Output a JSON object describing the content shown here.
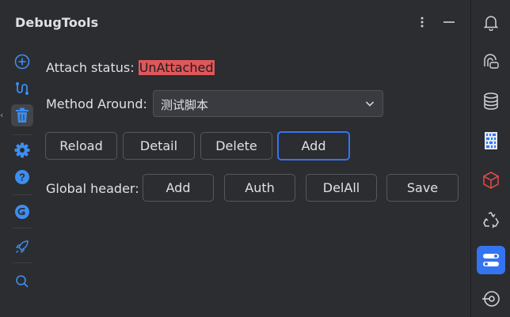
{
  "window": {
    "title": "DebugTools"
  },
  "header": {
    "more_icon": "vertical-ellipsis-icon",
    "minimize_icon": "minimize-icon"
  },
  "left_toolbar": [
    {
      "name": "add-circle-icon",
      "active": false
    },
    {
      "name": "route-icon",
      "active": false
    },
    {
      "name": "trash-icon",
      "active": true
    },
    {
      "name": "gear-icon",
      "active": false
    },
    {
      "name": "help-icon",
      "active": false
    },
    {
      "name": "gitee-icon",
      "active": false
    },
    {
      "name": "rocket-icon",
      "active": false
    },
    {
      "name": "search-icon",
      "active": false
    }
  ],
  "attach": {
    "label": "Attach status:",
    "status": "UnAttached",
    "status_color": "#e0575a"
  },
  "method": {
    "label": "Method Around:",
    "selected": "测试脚本"
  },
  "actions": {
    "reload": "Reload",
    "detail": "Detail",
    "delete": "Delete",
    "add": "Add"
  },
  "global_header": {
    "label": "Global header:",
    "add": "Add",
    "auth": "Auth",
    "delall": "DelAll",
    "save": "Save"
  },
  "right_toolbar": [
    {
      "name": "bell-icon",
      "active": false
    },
    {
      "name": "ai-assistant-icon",
      "active": false
    },
    {
      "name": "database-icon",
      "active": false
    },
    {
      "name": "binary-file-icon",
      "active": false
    },
    {
      "name": "cube-icon",
      "active": false
    },
    {
      "name": "recycle-icon",
      "active": false
    },
    {
      "name": "debug-tools-icon",
      "active": true
    },
    {
      "name": "target-icon",
      "active": false
    }
  ],
  "colors": {
    "accent": "#3574f0",
    "background": "#2b2d30",
    "danger": "#e0575a"
  }
}
